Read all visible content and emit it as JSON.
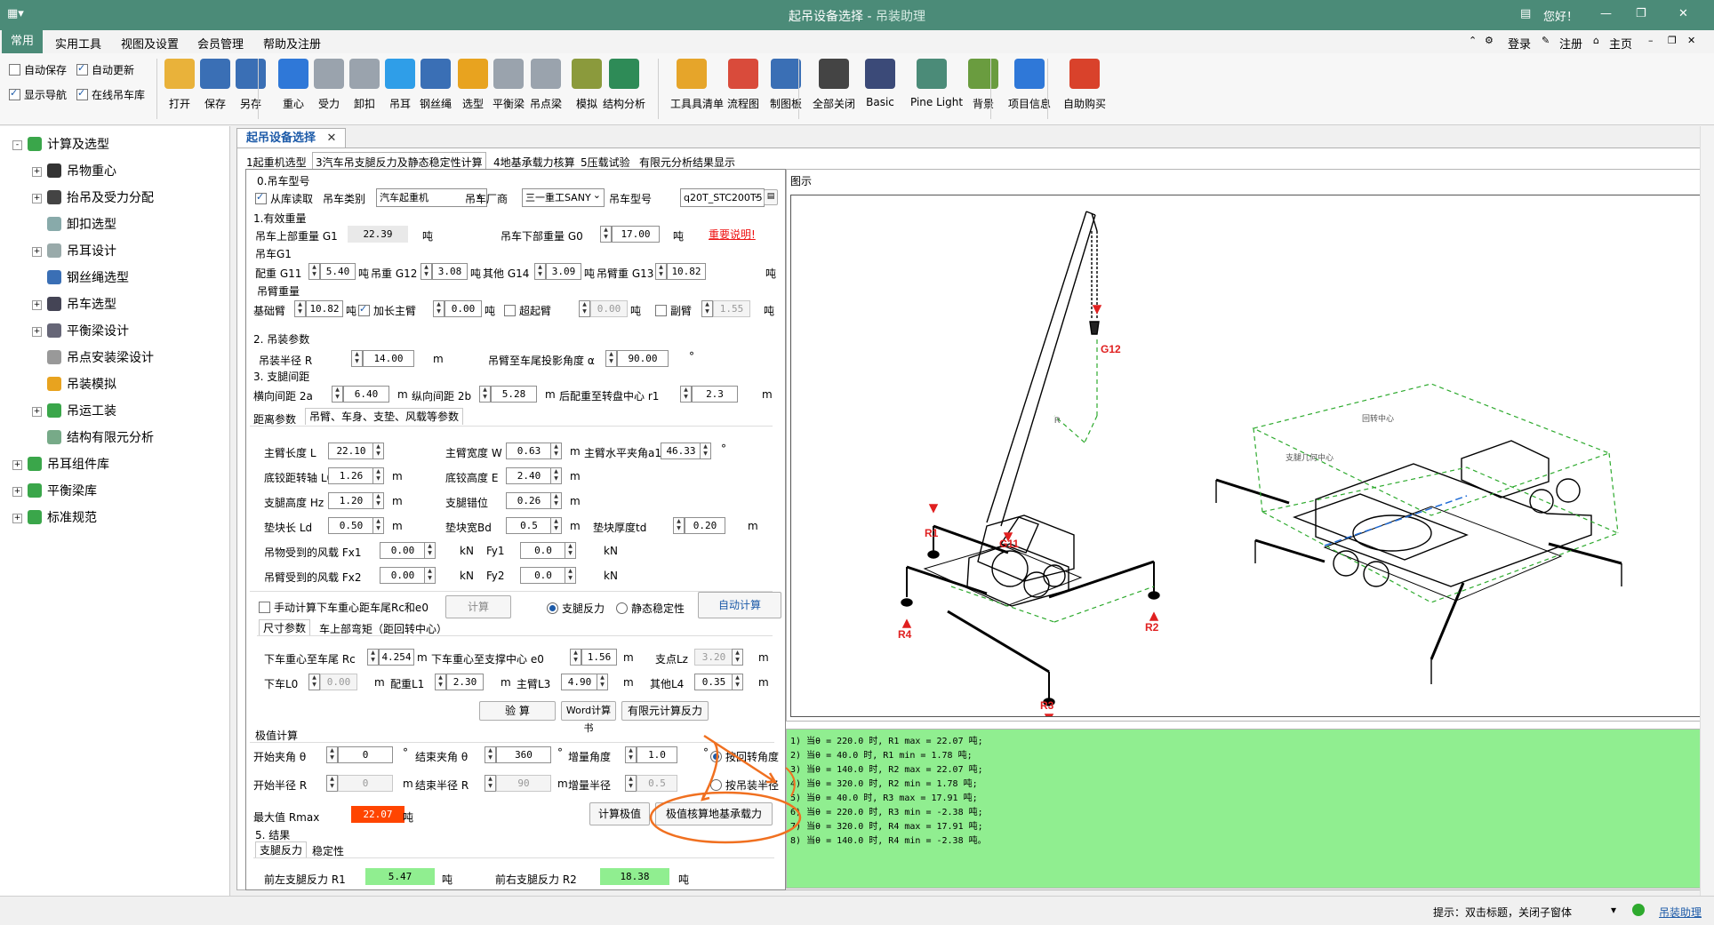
{
  "window": {
    "title": "起吊设备选择",
    "subtitle": "吊装助理",
    "greeting": "您好！"
  },
  "menu": {
    "tabs": [
      "常用",
      "实用工具",
      "视图及设置",
      "会员管理",
      "帮助及注册"
    ],
    "right": {
      "login": "登录",
      "register": "注册",
      "home": "主页"
    }
  },
  "ribbon": {
    "checkboxes": [
      {
        "label": "自动保存",
        "checked": false
      },
      {
        "label": "自动更新",
        "checked": true
      },
      {
        "label": "显示导航",
        "checked": true
      },
      {
        "label": "在线吊车库",
        "checked": true
      }
    ],
    "buttons": [
      {
        "label": "打开",
        "icon": "folder-open-icon",
        "color": "#e9b23a"
      },
      {
        "label": "保存",
        "icon": "save-icon",
        "color": "#3a6fb5"
      },
      {
        "label": "另存",
        "icon": "save-as-icon",
        "color": "#3a6fb5"
      },
      {
        "label": "重心",
        "icon": "center-of-gravity-icon",
        "color": "#2f78d8"
      },
      {
        "label": "受力",
        "icon": "force-icon",
        "color": "#9aa3ad"
      },
      {
        "label": "卸扣",
        "icon": "shackle-icon",
        "color": "#9aa3ad"
      },
      {
        "label": "吊耳",
        "icon": "lifting-lug-icon",
        "color": "#2f9ee8"
      },
      {
        "label": "钢丝绳",
        "icon": "wire-rope-icon",
        "color": "#3a6fb5"
      },
      {
        "label": "选型",
        "icon": "crane-selection-icon",
        "color": "#e8a31f"
      },
      {
        "label": "平衡梁",
        "icon": "spreader-beam-icon",
        "color": "#9aa3ad"
      },
      {
        "label": "吊点梁",
        "icon": "lifting-beam-icon",
        "color": "#9aa3ad"
      },
      {
        "label": "模拟",
        "icon": "simulation-icon",
        "color": "#8b9a3c"
      },
      {
        "label": "结构分析",
        "icon": "structure-analysis-icon",
        "color": "#2e8b57"
      },
      {
        "label": "工具具清单",
        "icon": "clipboard-icon",
        "color": "#e6a52a"
      },
      {
        "label": "流程图",
        "icon": "flowchart-icon",
        "color": "#d94b3b"
      },
      {
        "label": "制图板",
        "icon": "drawing-board-icon",
        "color": "#3a6fb5"
      },
      {
        "label": "全部关闭",
        "icon": "close-all-icon",
        "color": "#444444"
      },
      {
        "label": "Basic",
        "icon": "theme-basic-icon",
        "color": "#3b4a78"
      },
      {
        "label": "Pine Light",
        "icon": "theme-pine-icon",
        "color": "#4b8b78"
      },
      {
        "label": "背景",
        "icon": "background-icon",
        "color": "#6a9c3f"
      },
      {
        "label": "项目信息",
        "icon": "info-icon",
        "color": "#2f78d8"
      },
      {
        "label": "自助购买",
        "icon": "cart-icon",
        "color": "#d9422b"
      }
    ]
  },
  "tree": [
    {
      "label": "计算及选型",
      "level": 0,
      "expand": "-"
    },
    {
      "label": "吊物重心",
      "level": 1,
      "expand": "+"
    },
    {
      "label": "抬吊及受力分配",
      "level": 1,
      "expand": "+"
    },
    {
      "label": "卸扣选型",
      "level": 1,
      "expand": ""
    },
    {
      "label": "吊耳设计",
      "level": 1,
      "expand": "+"
    },
    {
      "label": "钢丝绳选型",
      "level": 1,
      "expand": ""
    },
    {
      "label": "吊车选型",
      "level": 1,
      "expand": "+"
    },
    {
      "label": "平衡梁设计",
      "level": 1,
      "expand": "+"
    },
    {
      "label": "吊点安装梁设计",
      "level": 1,
      "expand": ""
    },
    {
      "label": "吊装模拟",
      "level": 1,
      "expand": ""
    },
    {
      "label": "吊运工装",
      "level": 1,
      "expand": "+"
    },
    {
      "label": "结构有限元分析",
      "level": 1,
      "expand": ""
    },
    {
      "label": "吊耳组件库",
      "level": 0,
      "expand": "+"
    },
    {
      "label": "平衡梁库",
      "level": 0,
      "expand": "+"
    },
    {
      "label": "标准规范",
      "level": 0,
      "expand": "+"
    }
  ],
  "doc": {
    "tab": "起吊设备选择",
    "subtabs": [
      "1起重机选型",
      "3汽车吊支腿反力及静态稳定性计算",
      "4地基承载力核算",
      "5压载试验",
      "有限元分析结果显示"
    ]
  },
  "form": {
    "s0": "0.吊车型号",
    "from_lib": "从库读取",
    "crane_type_label": "吊车类别",
    "crane_type": "汽车起重机",
    "maker_label": "吊车厂商",
    "maker": "三一重工SANY",
    "model_label": "吊车型号",
    "model": "q20T_STC200T5",
    "s1": "1.有效重量",
    "g1_label": "吊车上部重量 G1",
    "g1": "22.39",
    "g1_unit": "吨",
    "g0_label": "吊车下部重量 G0",
    "g0": "17.00",
    "g0_unit": "吨",
    "important": "重要说明!",
    "crane_g1": "吊车G1",
    "g11_label": "配重 G11",
    "g11": "5.40",
    "g12_label": "吊重 G12",
    "g12": "3.08",
    "g14_label": "其他 G14",
    "g14": "3.09",
    "g13_label": "吊臂重 G13",
    "g13": "10.82",
    "t": "吨",
    "boom_weight": "吊臂重量",
    "base_boom_label": "基础臂",
    "base_boom": "10.82",
    "ext_boom_label": "加长主臂",
    "ext_boom": "0.00",
    "super_boom_label": "超起臂",
    "super_boom": "0.00",
    "jib_label": "副臂",
    "jib": "1.55",
    "s2": "2. 吊装参数",
    "radius_label": "吊装半径 R",
    "radius": "14.00",
    "m": "m",
    "angle_label": "吊臂至车尾投影角度 α",
    "angle": "90.00",
    "deg": "°",
    "s3": "3. 支腿间距",
    "a2_label": "横向间距 2a",
    "a2": "6.40",
    "b2_label": "纵向间距 2b",
    "b2": "5.28",
    "r1_label": "后配重至转盘中心 r1",
    "r1": "2.3",
    "itabs": [
      "距离参数",
      "吊臂、车身、支垫、风载等参数"
    ],
    "L_label": "主臂长度 L",
    "L": "22.10",
    "W_label": "主臂宽度 W",
    "W": "0.63",
    "a1_label": "主臂水平夹角a1",
    "a1": "46.33",
    "L0_label": "底铰距转轴 L0",
    "L0": "1.26",
    "E_label": "底铰高度 E",
    "E": "2.40",
    "Hz_label": "支腿高度 Hz",
    "Hz": "1.20",
    "leg_off_label": "支腿错位",
    "leg_off": "0.26",
    "Ld_label": "垫块长 Ld",
    "Ld": "0.50",
    "Bd_label": "垫块宽Bd",
    "Bd": "0.5",
    "td_label": "垫块厚度td",
    "td": "0.20",
    "Fx1_label": "吊物受到的风载 Fx1",
    "Fx1": "0.00",
    "Fy1_label": "Fy1",
    "Fy1": "0.0",
    "Fx2_label": "吊臂受到的风载 Fx2",
    "Fx2": "0.00",
    "Fy2_label": "Fy2",
    "Fy2": "0.0",
    "kN": "kN",
    "manual_label": "手动计算下车重心距车尾Rc和e0",
    "calc": "计算",
    "radio_leg": "支腿反力",
    "radio_static": "静态稳定性",
    "auto_calc": "自动计算",
    "dtabs": [
      "尺寸参数",
      "车上部弯矩（距回转中心）"
    ],
    "Rc_label": "下车重心至车尾 Rc",
    "Rc": "4.254",
    "e0_label": "下车重心至支撑中心 e0",
    "e0": "1.56",
    "Lz_label": "支点Lz",
    "Lz": "3.20",
    "L0b_label": "下车L0",
    "L0b": "0.00",
    "L1_label": "配重L1",
    "L1": "2.30",
    "L3_label": "主臂L3",
    "L3": "4.90",
    "L4_label": "其他L4",
    "L4": "0.35",
    "verify": "验 算",
    "word": "Word计算书",
    "fea": "有限元计算反力",
    "ext": "极值计算",
    "start_angle_label": "开始夹角 θ",
    "start_angle": "0",
    "end_angle_label": "结束夹角 θ",
    "end_angle": "360",
    "inc_angle_label": "增量角度",
    "inc_angle": "1.0",
    "by_angle": "按回转角度",
    "start_r_label": "开始半径 R",
    "start_r": "0",
    "end_r_label": "结束半径 R",
    "end_r": "90",
    "inc_r_label": "增量半径",
    "inc_r": "0.5",
    "by_radius": "按吊装半径",
    "max_label": "最大值 Rmax",
    "max": "22.07",
    "calc_ext": "计算极值",
    "check_ground": "极值核算地基承载力",
    "s5": "5. 结果",
    "rtabs": [
      "支腿反力",
      "稳定性"
    ],
    "R1_label": "前左支腿反力 R1",
    "R1": "5.47",
    "R2_label": "前右支腿反力 R2",
    "R2": "18.38"
  },
  "diagram": {
    "title": "图示",
    "labels": {
      "G12": "G12",
      "G11": "G11",
      "R": "R",
      "R1": "R1",
      "R2": "R2",
      "R3": "R3",
      "R4": "R4",
      "rot": "回转中心",
      "leg": "支腿几何中心"
    }
  },
  "output": [
    "1) 当θ = 220.0 时, R1 max = 22.07 吨;",
    "2) 当θ = 40.0 时, R1 min = 1.78 吨;",
    "3) 当θ = 140.0 时, R2 max = 22.07 吨;",
    "4) 当θ = 320.0 时, R2 min = 1.78 吨;",
    "5) 当θ = 40.0 时, R3 max = 17.91 吨;",
    "6) 当θ = 220.0 时, R3 min = -2.38 吨;",
    "7) 当θ = 320.0 时, R4 max = 17.91 吨;",
    "8) 当θ = 140.0 时, R4 min = -2.38 吨。"
  ],
  "status": {
    "hint": "提示：双击标题，关闭子窗体",
    "brand": "吊装助理"
  },
  "colors": {
    "accent": "#4b8b78",
    "highlight": "#ff4500",
    "result": "#90ee90",
    "annotation": "#f07020"
  }
}
